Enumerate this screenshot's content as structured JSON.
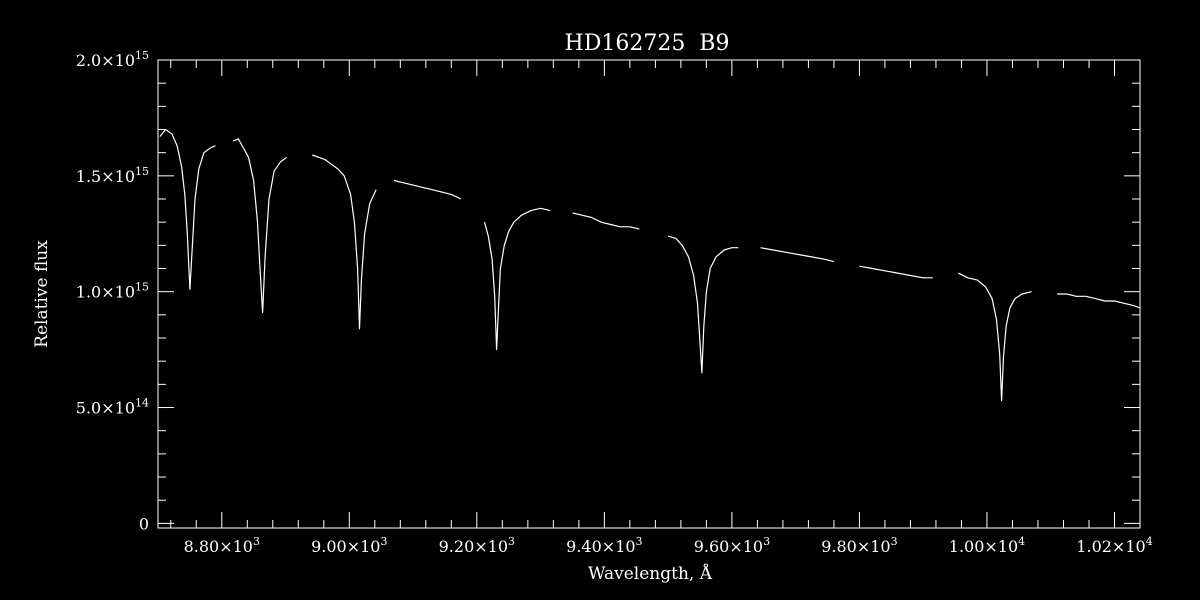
{
  "chart_data": {
    "type": "line",
    "title": "HD162725  B9",
    "xlabel": "Wavelength, Å",
    "ylabel": "Relative flux",
    "xlim": [
      8700,
      10240
    ],
    "ylim": [
      -20000000000000.0,
      2000000000000000.0
    ],
    "log_scale": false,
    "grid": false,
    "legend": "none",
    "x_ticks": [
      {
        "value": 8800,
        "mantissa": "8.80",
        "exponent": "3"
      },
      {
        "value": 9000,
        "mantissa": "9.00",
        "exponent": "3"
      },
      {
        "value": 9200,
        "mantissa": "9.20",
        "exponent": "3"
      },
      {
        "value": 9400,
        "mantissa": "9.40",
        "exponent": "3"
      },
      {
        "value": 9600,
        "mantissa": "9.60",
        "exponent": "3"
      },
      {
        "value": 9800,
        "mantissa": "9.80",
        "exponent": "3"
      },
      {
        "value": 10000,
        "mantissa": "1.00",
        "exponent": "4"
      },
      {
        "value": 10200,
        "mantissa": "1.02",
        "exponent": "4"
      }
    ],
    "y_ticks": [
      {
        "value": 0,
        "mantissa": "0",
        "exponent": ""
      },
      {
        "value": 500000000000000.0,
        "mantissa": "5.0",
        "exponent": "14"
      },
      {
        "value": 1000000000000000.0,
        "mantissa": "1.0",
        "exponent": "15"
      },
      {
        "value": 1500000000000000.0,
        "mantissa": "1.5",
        "exponent": "15"
      },
      {
        "value": 2000000000000000.0,
        "mantissa": "2.0",
        "exponent": "15"
      }
    ],
    "x_minor_step": 40,
    "y_minor_step": 100000000000000.0,
    "segments": [
      {
        "x": [
          8703,
          8712,
          8722,
          8730,
          8737,
          8742,
          8746,
          8750,
          8754,
          8758,
          8764,
          8772,
          8782,
          8790
        ],
        "y": [
          1670000000000000.0,
          1700000000000000.0,
          1680000000000000.0,
          1630000000000000.0,
          1540000000000000.0,
          1420000000000000.0,
          1250000000000000.0,
          1010000000000000.0,
          1200000000000000.0,
          1400000000000000.0,
          1530000000000000.0,
          1600000000000000.0,
          1620000000000000.0,
          1630000000000000.0
        ]
      },
      {
        "x": [
          8818,
          8826,
          8834,
          8842,
          8850,
          8856,
          8860,
          8864,
          8868,
          8874,
          8882,
          8892,
          8902
        ],
        "y": [
          1650000000000000.0,
          1660000000000000.0,
          1620000000000000.0,
          1580000000000000.0,
          1480000000000000.0,
          1300000000000000.0,
          1100000000000000.0,
          910000000000000.0,
          1150000000000000.0,
          1400000000000000.0,
          1520000000000000.0,
          1560000000000000.0,
          1580000000000000.0
        ]
      },
      {
        "x": [
          8942,
          8952,
          8962,
          8972,
          8982,
          8992,
          9002,
          9008,
          9013,
          9016,
          9019,
          9024,
          9032,
          9042
        ],
        "y": [
          1590000000000000.0,
          1580000000000000.0,
          1570000000000000.0,
          1550000000000000.0,
          1530000000000000.0,
          1500000000000000.0,
          1420000000000000.0,
          1300000000000000.0,
          1100000000000000.0,
          840000000000000.0,
          1050000000000000.0,
          1250000000000000.0,
          1380000000000000.0,
          1440000000000000.0
        ]
      },
      {
        "x": [
          9070,
          9085,
          9100,
          9115,
          9130,
          9145,
          9160,
          9175
        ],
        "y": [
          1480000000000000.0,
          1470000000000000.0,
          1460000000000000.0,
          1450000000000000.0,
          1440000000000000.0,
          1430000000000000.0,
          1420000000000000.0,
          1400000000000000.0
        ]
      },
      {
        "x": [
          9212,
          9218,
          9224,
          9228,
          9231,
          9234,
          9237,
          9243,
          9250,
          9258,
          9270,
          9285,
          9300,
          9315
        ],
        "y": [
          1300000000000000.0,
          1240000000000000.0,
          1140000000000000.0,
          980000000000000.0,
          750000000000000.0,
          930000000000000.0,
          1100000000000000.0,
          1200000000000000.0,
          1260000000000000.0,
          1300000000000000.0,
          1330000000000000.0,
          1350000000000000.0,
          1360000000000000.0,
          1350000000000000.0
        ]
      },
      {
        "x": [
          9350,
          9365,
          9380,
          9395,
          9410,
          9425,
          9440,
          9455
        ],
        "y": [
          1340000000000000.0,
          1330000000000000.0,
          1320000000000000.0,
          1300000000000000.0,
          1290000000000000.0,
          1280000000000000.0,
          1280000000000000.0,
          1270000000000000.0
        ]
      },
      {
        "x": [
          9500,
          9512,
          9522,
          9532,
          9540,
          9546,
          9550,
          9553,
          9556,
          9560,
          9566,
          9575,
          9588,
          9600,
          9610
        ],
        "y": [
          1240000000000000.0,
          1230000000000000.0,
          1200000000000000.0,
          1150000000000000.0,
          1070000000000000.0,
          950000000000000.0,
          780000000000000.0,
          650000000000000.0,
          850000000000000.0,
          1000000000000000.0,
          1100000000000000.0,
          1150000000000000.0,
          1180000000000000.0,
          1190000000000000.0,
          1190000000000000.0
        ]
      },
      {
        "x": [
          9645,
          9665,
          9685,
          9705,
          9725,
          9745,
          9760
        ],
        "y": [
          1190000000000000.0,
          1180000000000000.0,
          1170000000000000.0,
          1160000000000000.0,
          1150000000000000.0,
          1140000000000000.0,
          1130000000000000.0
        ]
      },
      {
        "x": [
          9800,
          9820,
          9840,
          9860,
          9880,
          9900,
          9915
        ],
        "y": [
          1110000000000000.0,
          1100000000000000.0,
          1090000000000000.0,
          1080000000000000.0,
          1070000000000000.0,
          1060000000000000.0,
          1060000000000000.0
        ]
      },
      {
        "x": [
          9955,
          9970,
          9985,
          9998,
          10008,
          10015,
          10020,
          10023,
          10026,
          10030,
          10036,
          10044,
          10055,
          10070
        ],
        "y": [
          1080000000000000.0,
          1060000000000000.0,
          1050000000000000.0,
          1020000000000000.0,
          970000000000000.0,
          880000000000000.0,
          730000000000000.0,
          530000000000000.0,
          720000000000000.0,
          850000000000000.0,
          930000000000000.0,
          970000000000000.0,
          990000000000000.0,
          1000000000000000.0
        ]
      },
      {
        "x": [
          10110,
          10125,
          10140,
          10155,
          10170,
          10185,
          10200,
          10215,
          10230,
          10240
        ],
        "y": [
          990000000000000.0,
          990000000000000.0,
          980000000000000.0,
          980000000000000.0,
          970000000000000.0,
          960000000000000.0,
          960000000000000.0,
          950000000000000.0,
          940000000000000.0,
          930000000000000.0
        ]
      }
    ]
  }
}
